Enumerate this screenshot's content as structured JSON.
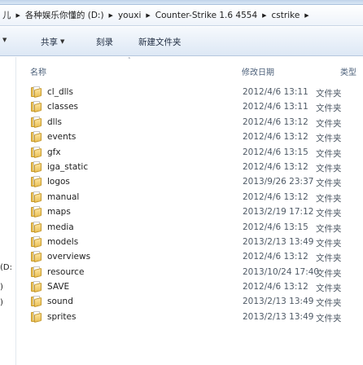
{
  "address": {
    "prefix": "儿",
    "drive": "各种娱乐你懂的 (D:)",
    "folder1": "youxi",
    "folder2": "Counter-Strike 1.6 4554",
    "folder3": "cstrike"
  },
  "toolbar": {
    "organize": "共享",
    "burn": "刻录",
    "new_folder": "新建文件夹"
  },
  "nav": {
    "item_drive": "(D:",
    "item_b": ")",
    "item_c": ")"
  },
  "columns": {
    "name": "名称",
    "date": "修改日期",
    "type": "类型"
  },
  "files": [
    {
      "name": "cl_dlls",
      "date": "2012/4/6 13:11",
      "type": "文件夹"
    },
    {
      "name": "classes",
      "date": "2012/4/6 13:11",
      "type": "文件夹"
    },
    {
      "name": "dlls",
      "date": "2012/4/6 13:12",
      "type": "文件夹"
    },
    {
      "name": "events",
      "date": "2012/4/6 13:12",
      "type": "文件夹"
    },
    {
      "name": "gfx",
      "date": "2012/4/6 13:15",
      "type": "文件夹"
    },
    {
      "name": "iga_static",
      "date": "2012/4/6 13:12",
      "type": "文件夹"
    },
    {
      "name": "logos",
      "date": "2013/9/26 23:37",
      "type": "文件夹"
    },
    {
      "name": "manual",
      "date": "2012/4/6 13:12",
      "type": "文件夹"
    },
    {
      "name": "maps",
      "date": "2013/2/19 17:12",
      "type": "文件夹"
    },
    {
      "name": "media",
      "date": "2012/4/6 13:15",
      "type": "文件夹"
    },
    {
      "name": "models",
      "date": "2013/2/13 13:49",
      "type": "文件夹"
    },
    {
      "name": "overviews",
      "date": "2012/4/6 13:12",
      "type": "文件夹"
    },
    {
      "name": "resource",
      "date": "2013/10/24 17:40",
      "type": "文件夹"
    },
    {
      "name": "SAVE",
      "date": "2012/4/6 13:12",
      "type": "文件夹"
    },
    {
      "name": "sound",
      "date": "2013/2/13 13:49",
      "type": "文件夹"
    },
    {
      "name": "sprites",
      "date": "2013/2/13 13:49",
      "type": "文件夹"
    }
  ]
}
